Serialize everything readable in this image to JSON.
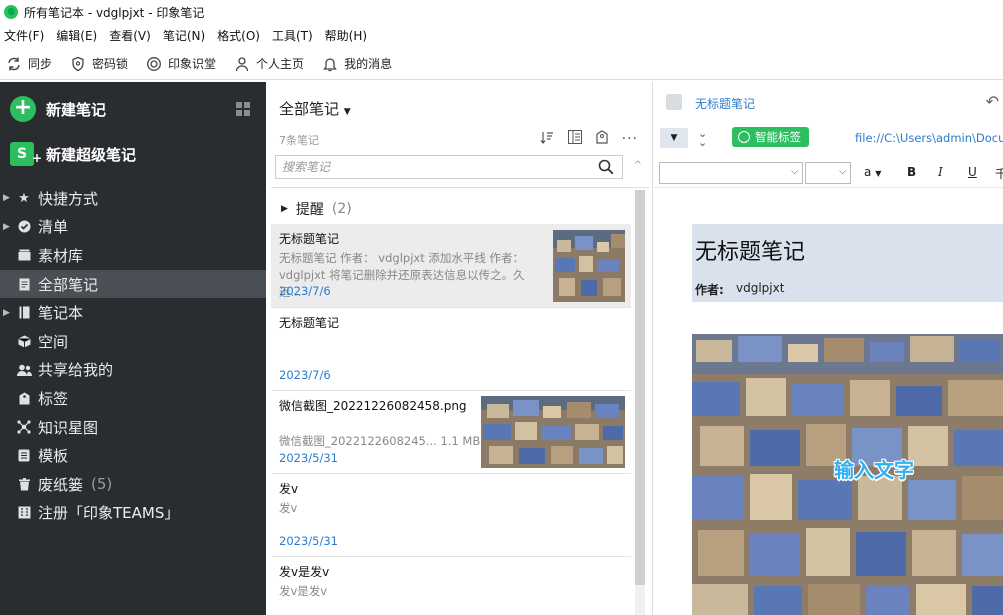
{
  "window": {
    "title": "所有笔记本 - vdglpjxt - 印象笔记"
  },
  "menu": [
    "文件(F)",
    "编辑(E)",
    "查看(V)",
    "笔记(N)",
    "格式(O)",
    "工具(T)",
    "帮助(H)"
  ],
  "toolbar": {
    "sync": "同步",
    "lock": "密码锁",
    "recognize": "印象识堂",
    "homepage": "个人主页",
    "messages": "我的消息"
  },
  "sidebar": {
    "new_note": "新建笔记",
    "new_super_note": "新建超级笔记",
    "items": [
      {
        "label": "快捷方式",
        "icon": "star-icon",
        "expandable": true
      },
      {
        "label": "清单",
        "icon": "check-circle-icon",
        "expandable": true
      },
      {
        "label": "素材库",
        "icon": "library-icon",
        "expandable": false
      },
      {
        "label": "全部笔记",
        "icon": "note-icon",
        "expandable": false,
        "active": true
      },
      {
        "label": "笔记本",
        "icon": "notebook-icon",
        "expandable": true
      },
      {
        "label": "空间",
        "icon": "cube-icon",
        "expandable": false
      },
      {
        "label": "共享给我的",
        "icon": "people-icon",
        "expandable": false
      },
      {
        "label": "标签",
        "icon": "tag-icon",
        "expandable": false
      },
      {
        "label": "知识星图",
        "icon": "graph-icon",
        "expandable": false
      },
      {
        "label": "模板",
        "icon": "template-icon",
        "expandable": false
      },
      {
        "label": "废纸篓",
        "icon": "trash-icon",
        "expandable": false,
        "count": "(5)"
      },
      {
        "label": "注册「印象TEAMS」",
        "icon": "building-icon",
        "expandable": false
      }
    ]
  },
  "notelist": {
    "title": "全部笔记",
    "count": "7条笔记",
    "search_placeholder": "搜索笔记",
    "reminder_label": "提醒",
    "reminder_count": "(2)",
    "notes": [
      {
        "title": "无标题笔记",
        "snippet": "无标题笔记 作者： vdglpjxt 添加水平线 作者： vdglpjxt 将笔记删除并还原表达信息以传之。久远...",
        "date": "2023/7/6",
        "selected": true,
        "has_thumb": true
      },
      {
        "title": "无标题笔记",
        "snippet": "",
        "date": "2023/7/6",
        "selected": false,
        "has_thumb": false
      },
      {
        "title": "微信截图_20221226082458.png",
        "snippet": "微信截图_2022122608245... 1.1 MB",
        "date": "2023/5/31",
        "selected": false,
        "has_thumb": true
      },
      {
        "title": "发v",
        "snippet": "发v",
        "date": "2023/5/31",
        "selected": false,
        "has_thumb": false
      },
      {
        "title": "发v是发v",
        "snippet": "发v是发v",
        "date": "",
        "selected": false,
        "has_thumb": false
      }
    ]
  },
  "editor": {
    "note_title_link": "无标题笔记",
    "smart_tag": "智能标签",
    "file_path": "file://C:\\Users\\admin\\Docu",
    "format": {
      "font_size_a": "a",
      "bold": "B",
      "italic": "I",
      "underline": "U",
      "strike": "千"
    },
    "doc_title": "无标题笔记",
    "author_label": "作者:",
    "author": "vdglpjxt",
    "image_text": "输入文字"
  },
  "colors": {
    "accent_green": "#2dbe60",
    "sidebar_bg": "#2a2d30",
    "link_blue": "#2b7bd0"
  }
}
